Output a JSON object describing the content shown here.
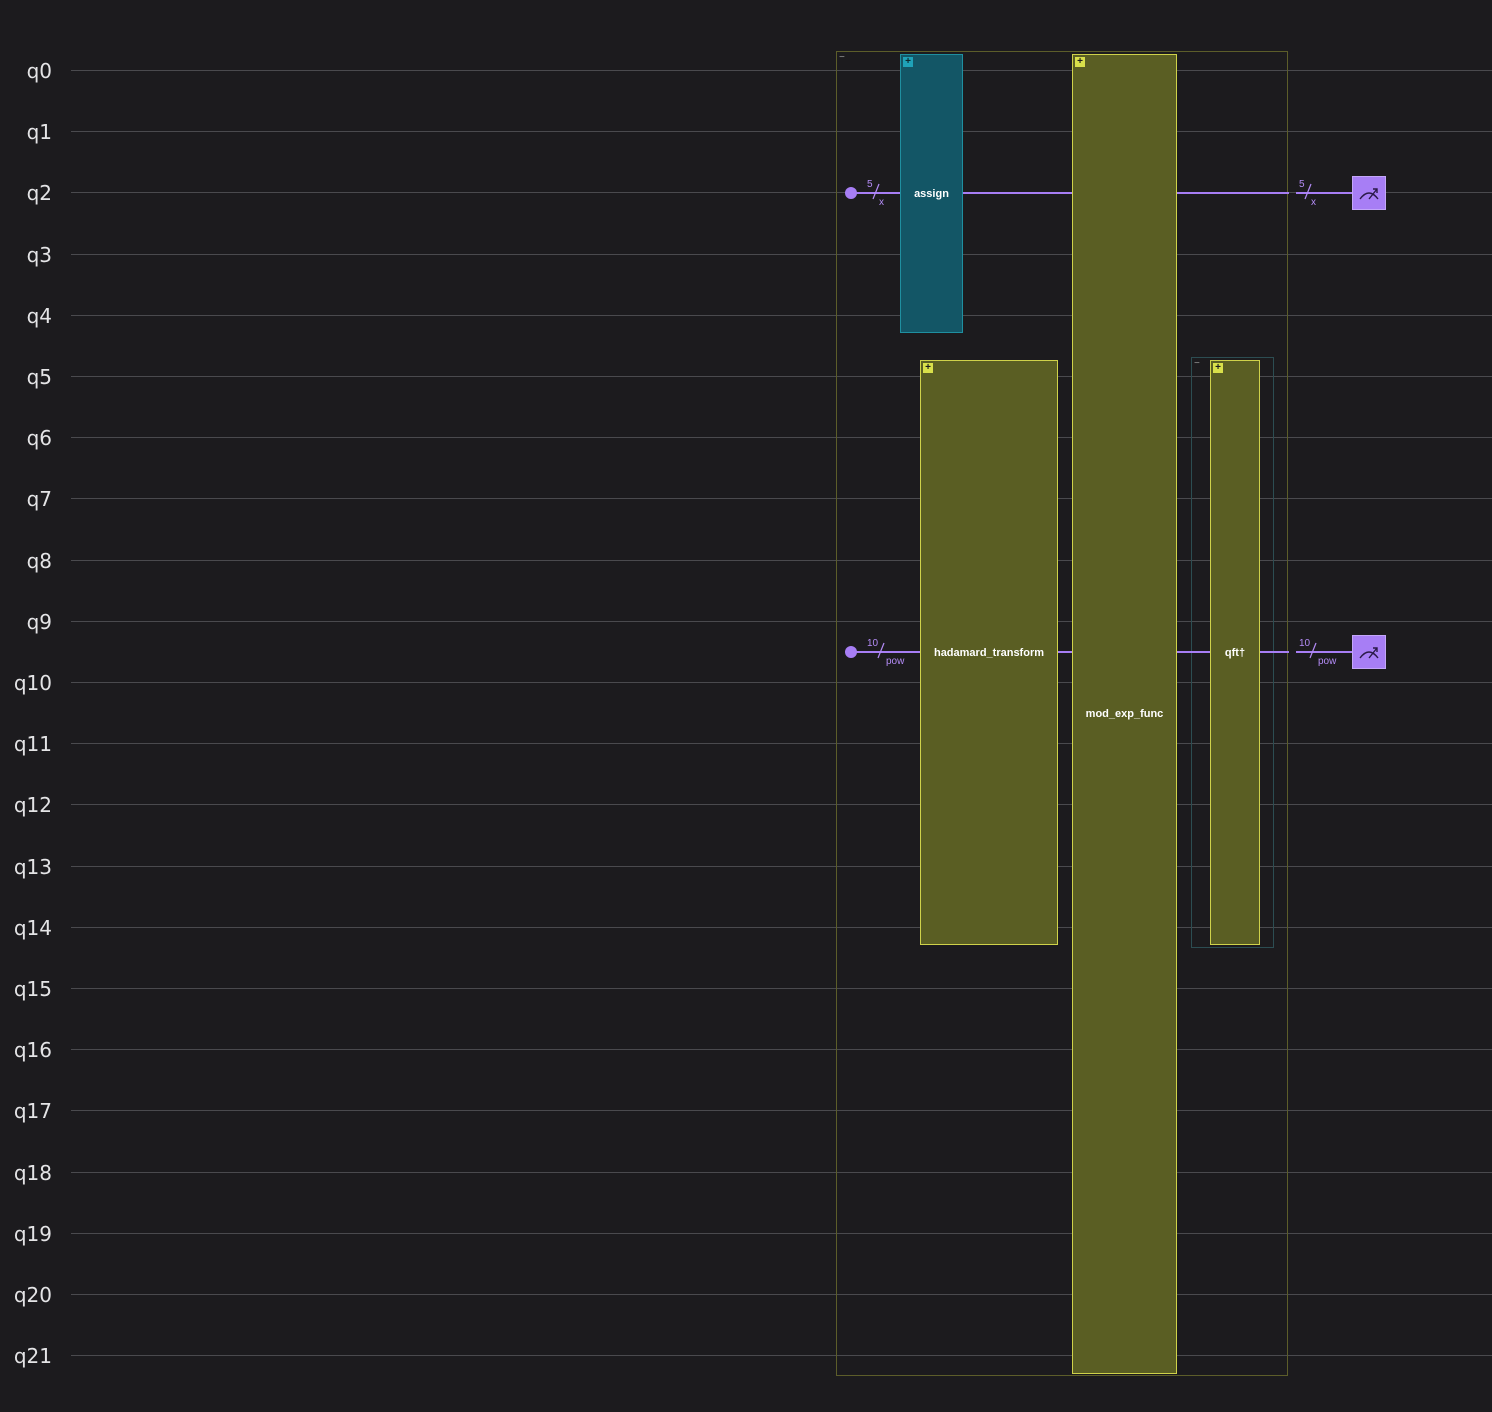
{
  "qubits": [
    "q0",
    "q1",
    "q2",
    "q3",
    "q4",
    "q5",
    "q6",
    "q7",
    "q8",
    "q9",
    "q10",
    "q11",
    "q12",
    "q13",
    "q14",
    "q15",
    "q16",
    "q17",
    "q18",
    "q19",
    "q20",
    "q21"
  ],
  "groups": {
    "outer_collapse": "−",
    "qft_collapse": "−"
  },
  "gates": {
    "assign": {
      "label": "assign",
      "expand": "+",
      "qubits": "q0–q4",
      "color": "#135666"
    },
    "hadamard": {
      "label": "hadamard_transform",
      "expand": "+",
      "qubits": "q5–q14",
      "color": "#5a5e23"
    },
    "mod_exp": {
      "label": "mod_exp_func",
      "expand": "+",
      "qubits": "q0–q21",
      "color": "#5a5e23"
    },
    "qft": {
      "label": "qft†",
      "expand": "+",
      "qubits": "q5–q14",
      "color": "#5a5e23"
    }
  },
  "registers": {
    "x": {
      "width_in": "5",
      "name_in": "x",
      "width_out": "5",
      "name_out": "x"
    },
    "pow": {
      "width_in": "10",
      "name_in": "pow",
      "width_out": "10",
      "name_out": "pow"
    }
  },
  "measure": {
    "icon": "measure-icon",
    "color": "#a77ef5"
  }
}
